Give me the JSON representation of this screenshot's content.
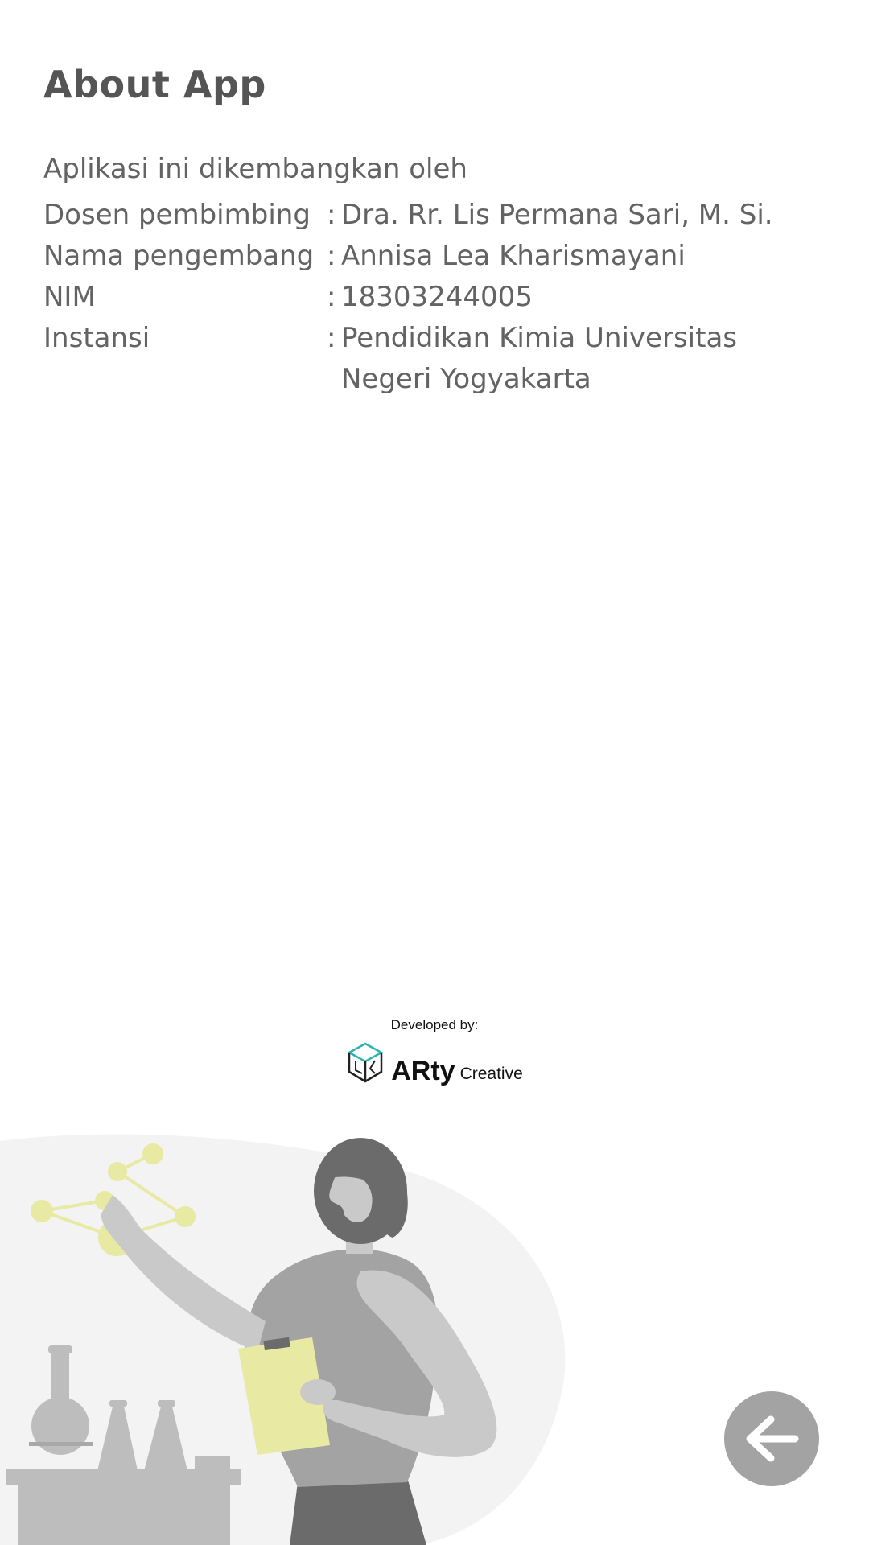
{
  "header": {
    "title": "About App"
  },
  "about": {
    "intro": "Aplikasi ini dikembangkan oleh",
    "rows": [
      {
        "label": "Dosen pembimbing",
        "sep": ":",
        "value": "Dra. Rr. Lis Permana Sari, M. Si."
      },
      {
        "label": "Nama pengembang",
        "sep": ":",
        "value": "Annisa Lea Kharismayani"
      },
      {
        "label": "NIM",
        "sep": ":",
        "value": "18303244005"
      },
      {
        "label": "Instansi",
        "sep": ":",
        "value": "Pendidikan Kimia Universitas Negeri Yogyakarta"
      }
    ]
  },
  "developer": {
    "caption": "Developed by:",
    "brand": "ARty",
    "brand_sub": "Creative"
  },
  "navigation": {
    "back_icon": "arrow-left-icon"
  },
  "colors": {
    "text": "#636363",
    "title": "#555555",
    "accent_yellow": "#e8eaa3",
    "back_button": "#a3a3a3",
    "blob": "#f3f3f3"
  }
}
